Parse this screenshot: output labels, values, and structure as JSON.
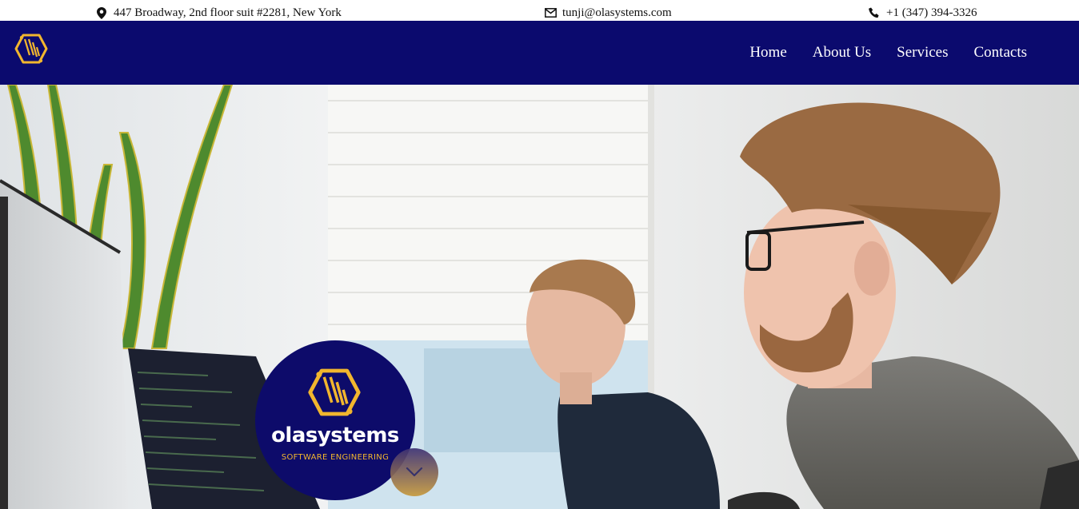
{
  "topbar": {
    "address": "447 Broadway, 2nd floor suit #2281, New York",
    "email": "tunji@olasystems.com",
    "phone": "+1 (347) 394-3326",
    "icons": {
      "address": "map-pin-icon",
      "email": "envelope-icon",
      "phone": "phone-icon"
    }
  },
  "nav": {
    "logo": "olasystems-logo-icon",
    "items": [
      {
        "label": "Home"
      },
      {
        "label": "About Us"
      },
      {
        "label": "Services"
      },
      {
        "label": "Contacts"
      }
    ]
  },
  "hero": {
    "brand": "olasystems",
    "tagline": "SOFTWARE ENGINEERING",
    "scroll_icon": "chevron-down-icon"
  },
  "colors": {
    "navbar": "#0b0a6e",
    "badge": "#0d0b6a",
    "accent": "#f1b62e",
    "text": "#111111"
  }
}
